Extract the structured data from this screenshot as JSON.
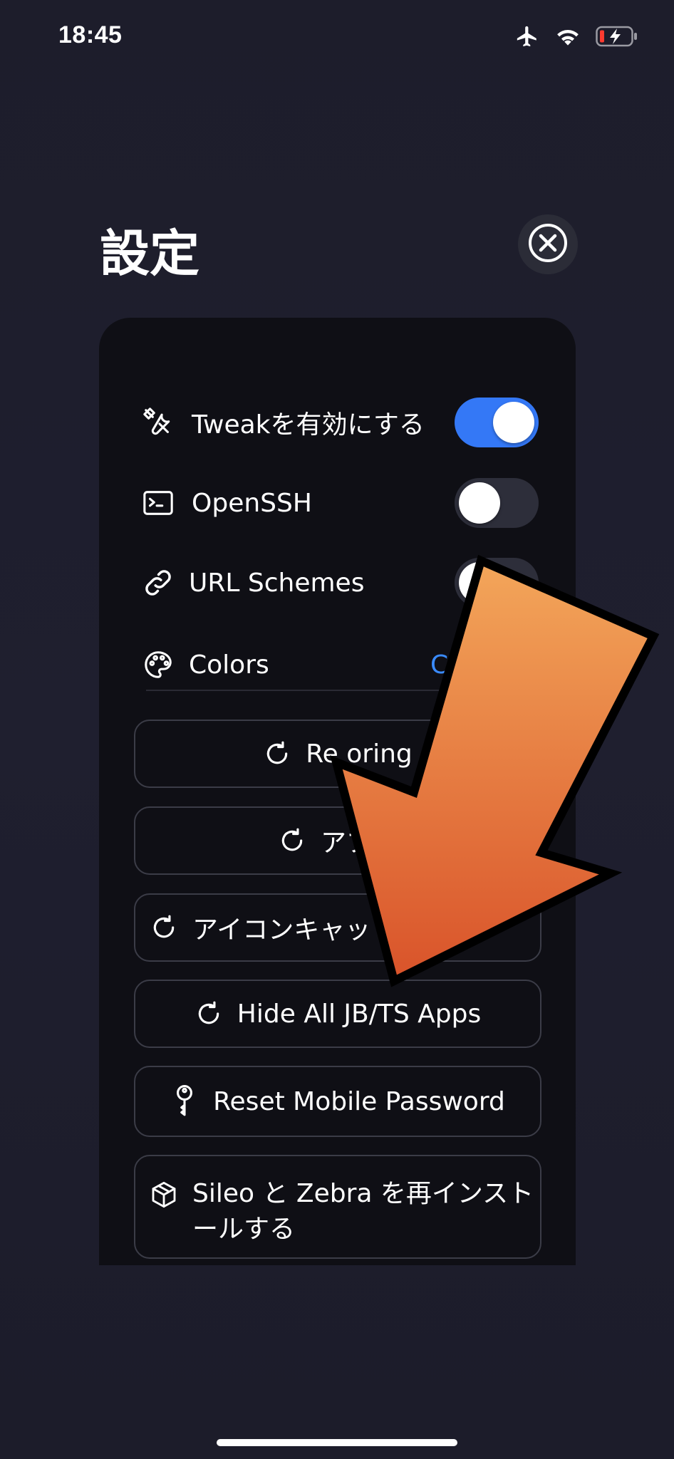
{
  "status_bar": {
    "time": "18:45",
    "icons": [
      "airplane-icon",
      "wifi-icon",
      "battery-charging-icon"
    ],
    "battery_color": "#ff3b30"
  },
  "header": {
    "title": "設定",
    "close_icon": "close-circle-icon"
  },
  "settings": {
    "rows": [
      {
        "icon": "tools-icon",
        "label": "Tweakを有効にする",
        "toggle": true
      },
      {
        "icon": "terminal-icon",
        "label": "OpenSSH",
        "toggle": false
      },
      {
        "icon": "link-icon",
        "label": "URL Schemes",
        "toggle": false
      },
      {
        "icon": "palette-icon",
        "label": "Colors",
        "value": "Co"
      }
    ],
    "buttons": [
      {
        "icon": "refresh-icon",
        "label": "Re   oring"
      },
      {
        "icon": "refresh-icon",
        "label": "アプリ"
      },
      {
        "icon": "refresh-icon",
        "label": "アイコンキャッ"
      },
      {
        "icon": "refresh-icon",
        "label": "Hide All JB/TS Apps"
      },
      {
        "icon": "key-icon",
        "label": "Reset Mobile Password"
      },
      {
        "icon": "box-icon",
        "label": "Sileo と Zebra を再インストールする"
      }
    ]
  },
  "colors": {
    "accent": "#3478f6",
    "arrow_fill_top": "#f3a65a",
    "arrow_fill_bottom": "#d9532a"
  }
}
